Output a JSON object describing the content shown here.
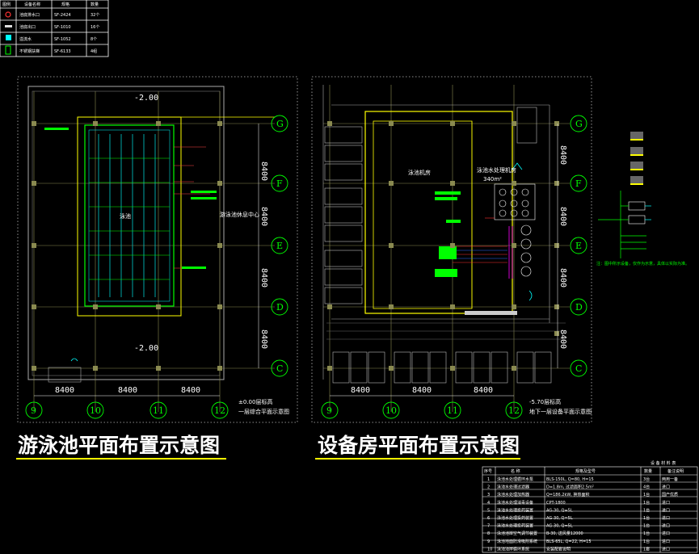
{
  "legend": {
    "headers": [
      "图例",
      "设备名称",
      "规格",
      "数量"
    ],
    "rows": [
      {
        "icon": "red-circle",
        "name": "池底排水口",
        "spec": "SF-2424",
        "qty": "32个"
      },
      {
        "icon": "white-dash",
        "name": "池底出口",
        "spec": "SF-1010",
        "qty": "16个"
      },
      {
        "icon": "cyan-square",
        "name": "溢流水",
        "spec": "SF-1052",
        "qty": "8个"
      },
      {
        "icon": "green-rect",
        "name": "不锈钢扶梯",
        "spec": "SF-6133",
        "qty": "4组"
      }
    ]
  },
  "left_plan": {
    "title": "游泳池平面布置示意图",
    "subtitle_level": "±0.00层标高",
    "subtitle_name": "一层综合平面示意图",
    "pool_label": "泳池",
    "side_label": "游泳池休息中心",
    "elev_top": "-2.00",
    "elev_bottom": "-2.00",
    "dims_bottom": [
      "8400",
      "8400",
      "8400"
    ],
    "dims_right": [
      "8400",
      "8400",
      "8400",
      "8400"
    ],
    "axes_bottom": [
      "9",
      "10",
      "11",
      "12"
    ],
    "axes_right": [
      "G",
      "F",
      "E",
      "D",
      "C"
    ]
  },
  "right_plan": {
    "title": "设备房平面布置示意图",
    "subtitle_level": "-5.70层标高",
    "subtitle_name": "地下一层设备平面示意图",
    "room_label": "泳池机房",
    "equip_label": "泳池水处理机房",
    "equip_elev": "340m²",
    "dims_bottom": [
      "8400",
      "8400",
      "8400"
    ],
    "dims_right": [
      "8400",
      "8400",
      "8400",
      "8400"
    ],
    "axes_bottom": [
      "9",
      "10",
      "11",
      "12"
    ],
    "axes_right": [
      "G",
      "F",
      "E",
      "D",
      "C"
    ]
  },
  "side_note": "注：图中所示设备，仅作为示意，具体以实际为准。",
  "materials": {
    "title": "设 备 材 料 表",
    "headers": [
      "序号",
      "名 称",
      "规格及型号",
      "数量",
      "备注说明"
    ],
    "rows": [
      [
        "1",
        "泳池水处理循环水泵",
        "BLS-150L, Q=80, H=15",
        "3台",
        "两用一备"
      ],
      [
        "2",
        "泳池水处理过滤器",
        "D=1.8m, 过滤面积2.5m²",
        "4台",
        "进口"
      ],
      [
        "3",
        "泳池水处理加热器",
        "Q=186.2kW, 换热面积",
        "1台",
        "国产优质"
      ],
      [
        "4",
        "泳池水处理消毒设备",
        "CPT-1800",
        "1台",
        "进口"
      ],
      [
        "5",
        "泳池水处理投药装置",
        "AG-30, Q=5L",
        "1台",
        "进口"
      ],
      [
        "6",
        "泳池水处理投药装置",
        "AG-30, Q=5L",
        "1台",
        "进口"
      ],
      [
        "7",
        "泳池水处理投药装置",
        "AG-30, Q=5L",
        "1台",
        "进口"
      ],
      [
        "8",
        "泳池池岸空气调节装置",
        "B-30, 送风量12000",
        "1台",
        "进口"
      ],
      [
        "9",
        "泳池地面防滑吸附系统",
        "BLS-65L, Q=22, H=15",
        "1台",
        "进口"
      ],
      [
        "10",
        "泳池池岸循环系统",
        "安装配套说明",
        "1套",
        "进口"
      ]
    ]
  },
  "colors": {
    "background": "#000000",
    "yellow": "#ffff00",
    "green": "#00ff00",
    "cyan": "#00ffff",
    "red": "#ff0000",
    "magenta": "#ff00ff",
    "olive": "#8a8a50"
  }
}
